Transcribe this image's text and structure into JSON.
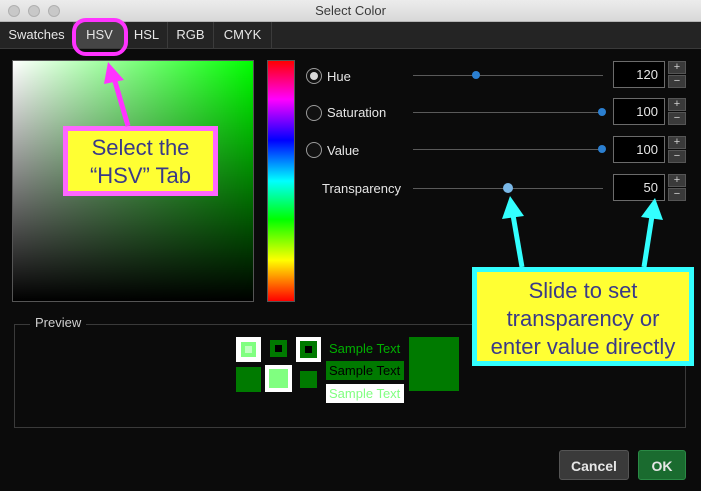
{
  "window": {
    "title": "Select Color"
  },
  "tabs": [
    {
      "label": "Swatches"
    },
    {
      "label": "HSV"
    },
    {
      "label": "HSL"
    },
    {
      "label": "RGB"
    },
    {
      "label": "CMYK"
    }
  ],
  "active_tab": "HSV",
  "controls": {
    "hue": {
      "label": "Hue",
      "value": "120",
      "selected": true
    },
    "saturation": {
      "label": "Saturation",
      "value": "100"
    },
    "value": {
      "label": "Value",
      "value": "100"
    },
    "transparency": {
      "label": "Transparency",
      "value": "50"
    }
  },
  "stepper": {
    "plus": "+",
    "minus": "−"
  },
  "preview": {
    "label": "Preview",
    "sample_text": "Sample Text"
  },
  "buttons": {
    "cancel": "Cancel",
    "ok": "OK"
  },
  "annotations": {
    "tab_callout": {
      "line1": "Select the",
      "line2": "“HSV” Tab"
    },
    "slider_callout": {
      "line1": "Slide to set",
      "line2": "transparency or",
      "line3": "enter value directly"
    }
  },
  "colors": {
    "accent_ring": "#ff33ff",
    "callout_border_tab": "#ff66ff",
    "callout_border_slider": "#33ffff",
    "callout_fill": "#ffff33",
    "ok_button": "#1a6b2f",
    "preview_green": "#007a00"
  }
}
